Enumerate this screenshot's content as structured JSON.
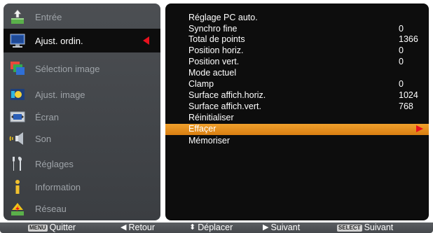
{
  "left_menu": {
    "items": [
      {
        "label": "Entrée",
        "icon": "input-arrow-icon",
        "active": false
      },
      {
        "label": "Ajust. ordin.",
        "icon": "computer-monitor-icon",
        "active": true
      },
      {
        "label": "Sélection image",
        "icon": "image-select-icon",
        "active": false
      },
      {
        "label": "Ajust. image",
        "icon": "image-adjust-icon",
        "active": false
      },
      {
        "label": "Écran",
        "icon": "screen-resize-icon",
        "active": false
      },
      {
        "label": "Son",
        "icon": "speaker-icon",
        "active": false
      },
      {
        "label": "Réglages",
        "icon": "tools-icon",
        "active": false
      },
      {
        "label": "Information",
        "icon": "info-icon",
        "active": false
      },
      {
        "label": "Réseau",
        "icon": "network-icon",
        "active": false
      }
    ]
  },
  "right_menu": {
    "rows": [
      {
        "label": "Réglage PC auto.",
        "value": ""
      },
      {
        "label": "Synchro fine",
        "value": "0"
      },
      {
        "label": "Total de points",
        "value": "1366"
      },
      {
        "label": "Position horiz.",
        "value": "0"
      },
      {
        "label": "Position vert.",
        "value": "0"
      },
      {
        "label": "Mode actuel",
        "value": ""
      },
      {
        "label": "Clamp",
        "value": "0"
      },
      {
        "label": "Surface affich.horiz.",
        "value": "1024"
      },
      {
        "label": "Surface affich.vert.",
        "value": "768"
      },
      {
        "label": "Réinitialiser",
        "value": ""
      },
      {
        "label": "Effaçer",
        "value": "",
        "selected": true
      },
      {
        "label": "Mémoriser",
        "value": ""
      }
    ]
  },
  "bottom_bar": {
    "quit": {
      "key": "MENU",
      "label": "Quitter"
    },
    "back": {
      "label": "Retour"
    },
    "move": {
      "label": "Déplacer"
    },
    "next": {
      "label": "Suivant"
    },
    "select": {
      "key": "SELECT",
      "label": "Suivant"
    }
  },
  "colors": {
    "accent_red": "#e8111e",
    "selection_orange": "#e98f1d",
    "left_panel": "#46494d",
    "right_panel": "#0d0d0d"
  }
}
